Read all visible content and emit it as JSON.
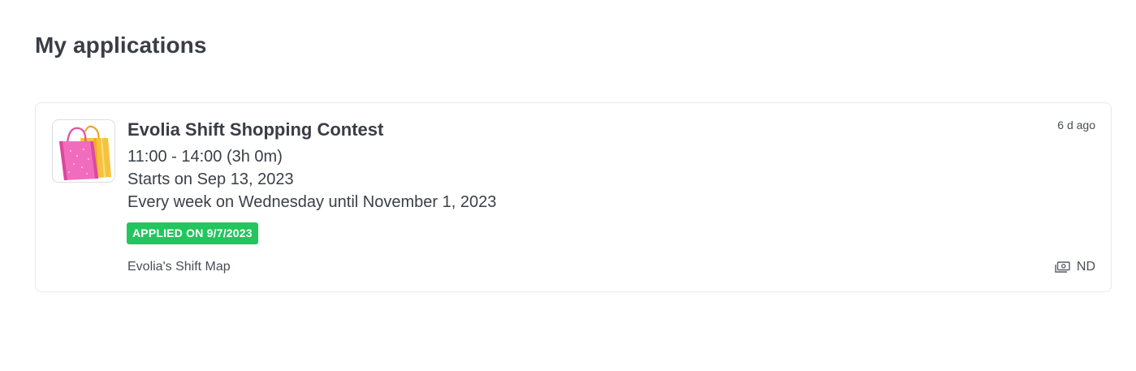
{
  "page": {
    "title": "My applications"
  },
  "application": {
    "thumbnail_icon": "shopping-bags-icon",
    "title": "Evolia Shift Shopping Contest",
    "time_range": "11:00 - 14:00 (3h 0m)",
    "start_date": "Starts on Sep 13, 2023",
    "recurrence": "Every week on Wednesday until November 1, 2023",
    "status_badge": "APPLIED ON 9/7/2023",
    "status_color": "#22c55e",
    "map_name": "Evolia's Shift Map",
    "posted_ago": "6 d ago",
    "pay_icon": "cash-icon",
    "pay_label": "ND"
  }
}
